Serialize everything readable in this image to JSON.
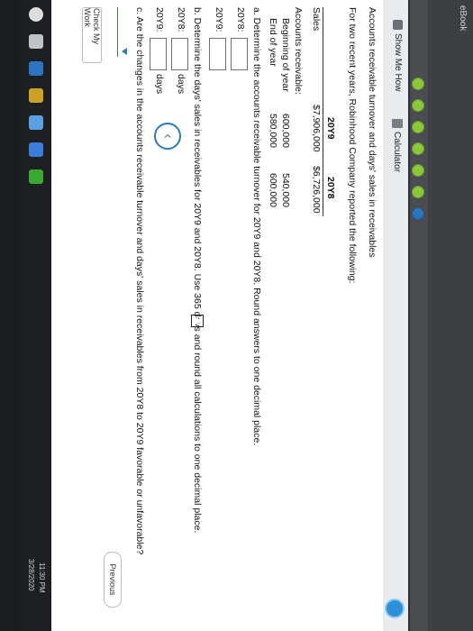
{
  "header": {
    "tab_label": "eBook"
  },
  "toolbar": {
    "show_me_how": "Show Me How",
    "calculator": "Calculator"
  },
  "problem": {
    "title": "Accounts receivable turnover and days' sales in receivables",
    "intro": "For two recent years, Robinhood Company reported the following:",
    "table": {
      "col1": "20Y9",
      "col2": "20Y8",
      "rows": [
        {
          "label": "Sales",
          "v1": "$7,906,000",
          "v2": "$6,726,000"
        },
        {
          "label": "Accounts receivable:",
          "v1": "",
          "v2": ""
        },
        {
          "label": "Beginning of year",
          "v1": "600,000",
          "v2": "540,000"
        },
        {
          "label": "End of year",
          "v1": "580,000",
          "v2": "600,000"
        }
      ]
    },
    "part_a": {
      "prompt": "a. Determine the accounts receivable turnover for 20Y9 and 20Y8. Round answers to one decimal place.",
      "row1": "20Y8:",
      "row2": "20Y9:"
    },
    "part_b": {
      "prompt": "b. Determine the days' sales in receivables for 20Y9 and 20Y8. Use 365 days and round all calculations to one decimal place.",
      "row1": "20Y8:",
      "row2": "20Y9:",
      "unit": "days"
    },
    "part_c": {
      "prompt": "c. Are the changes in the accounts receivable turnover and days' sales in receivables from 20Y8 to 20Y9 favorable or unfavorable?",
      "dropdown_value": ""
    }
  },
  "footer": {
    "check_my_work": "Check My Work",
    "previous": "Previous"
  },
  "taskbar": {
    "time": "11:30 PM",
    "date": "3/28/2020"
  }
}
